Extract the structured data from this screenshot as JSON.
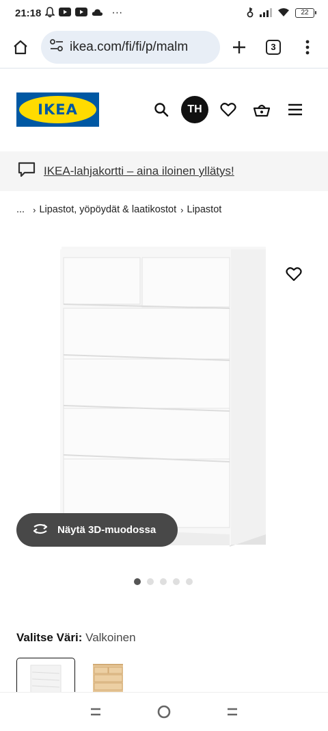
{
  "status_bar": {
    "time": "21:18",
    "more": "···",
    "battery": "22"
  },
  "browser": {
    "url": "ikea.com/fi/fi/p/malm",
    "tab_count": "3"
  },
  "header": {
    "logo_text": "IKEA",
    "avatar_initials": "TH"
  },
  "promo": {
    "text": "IKEA-lahjakortti – aina iloinen yllätys!"
  },
  "breadcrumb": {
    "ellipsis": "...",
    "items": [
      "Lipastot, yöpöydät & laatikostot",
      "Lipastot"
    ]
  },
  "product": {
    "view_3d_label": "Näytä 3D-muodossa",
    "carousel": {
      "count": 5,
      "active_index": 0
    }
  },
  "color_select": {
    "label": "Valitse Väri:",
    "value": "Valkoinen",
    "options": [
      {
        "name": "white-option",
        "selected": true
      },
      {
        "name": "oak-option",
        "selected": false
      }
    ]
  },
  "colors": {
    "ikea_blue": "#0058a3",
    "ikea_yellow": "#ffdb00",
    "pill_background": "#484848",
    "promo_background": "#f5f5f5"
  },
  "icons": [
    "home-icon",
    "site-settings-icon",
    "new-tab-icon",
    "tab-switcher-icon",
    "menu-dots-icon",
    "search-icon",
    "heart-icon",
    "cart-icon",
    "hamburger-icon",
    "chat-icon",
    "rotate-3d-icon",
    "back-nav-icon",
    "home-nav-icon",
    "recents-nav-icon"
  ]
}
